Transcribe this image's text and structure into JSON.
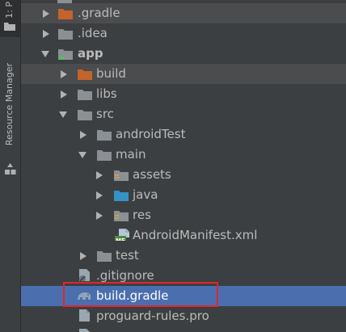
{
  "sidebar": {
    "project_tab": "1: P",
    "resource_manager": "Resource Manager"
  },
  "tree": [
    {
      "label": "root-partial",
      "text": ""
    },
    {
      "label": ".gradle"
    },
    {
      "label": ".idea"
    },
    {
      "label": "app"
    },
    {
      "label": "build"
    },
    {
      "label": "libs"
    },
    {
      "label": "src"
    },
    {
      "label": "androidTest"
    },
    {
      "label": "main"
    },
    {
      "label": "assets"
    },
    {
      "label": "java"
    },
    {
      "label": "res"
    },
    {
      "label": "AndroidManifest.xml"
    },
    {
      "label": "test"
    },
    {
      "label": ".gitignore"
    },
    {
      "label": "build.gradle"
    },
    {
      "label": "proguard-rules.pro"
    }
  ],
  "colors": {
    "background": "#3c3f41",
    "selection": "#4b6eaf",
    "highlight": "#4a4c4e",
    "excluded_folder": "#c2642b",
    "folder": "#8b9095",
    "source_folder": "#3592c4",
    "annotation_box": "#e0262b"
  },
  "icons": {
    "manifest_badge": "MF"
  }
}
